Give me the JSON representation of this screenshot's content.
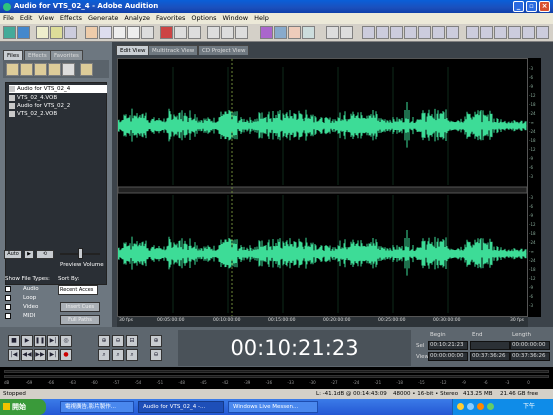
{
  "window": {
    "title": "Audio for VTS_02_4 - Adobe Audition"
  },
  "menu": [
    "File",
    "Edit",
    "View",
    "Effects",
    "Generate",
    "Analyze",
    "Favorites",
    "Options",
    "Window",
    "Help"
  ],
  "left": {
    "tabs": [
      "Files",
      "Effects",
      "Favorites"
    ],
    "files": [
      "Audio for VTS_02_4",
      "VTS_02_4.VOB",
      "Audio for VTS_02_2",
      "VTS_02_2.VOB"
    ],
    "auto_label": "Auto",
    "preview_volume": "Preview Volume",
    "show_file_types": "Show File Types:",
    "sort_by": "Sort By:",
    "sort_value": "Recent Acces",
    "types": [
      "Audio",
      "Loop",
      "Video",
      "MIDI"
    ],
    "insert_cue": "Insert Cues",
    "full_paths": "Full Paths"
  },
  "views": [
    "Edit View",
    "Multitrack View",
    "CD Project View"
  ],
  "timeline": [
    "30 fps",
    "00:05:00:00",
    "00:10:00:00",
    "00:15:00:00",
    "00:20:00:00",
    "00:25:00:00",
    "00:30:00:00",
    "30 fps"
  ],
  "ruler_top": [
    "-3",
    "-6",
    "-9",
    "-12",
    "-18",
    "-24",
    "-∞",
    "-24",
    "-18",
    "-12",
    "-9",
    "-6",
    "-3"
  ],
  "ruler_bot": [
    "-3",
    "-6",
    "-9",
    "-12",
    "-18",
    "-24",
    "-∞",
    "-24",
    "-18",
    "-12",
    "-9",
    "-6",
    "-3"
  ],
  "time_display": "00:10:21:23",
  "selection": {
    "headers": [
      "Begin",
      "End",
      "Length"
    ],
    "sel_label": "Sel",
    "view_label": "View",
    "sel": [
      "00:10:21:23",
      "",
      "00:00:00:00"
    ],
    "view": [
      "00:00:00:00",
      "00:37:36:26",
      "00:37:36:26"
    ]
  },
  "meter_scale": [
    "dB",
    "-69",
    "-66",
    "-63",
    "-60",
    "-57",
    "-54",
    "-51",
    "-48",
    "-45",
    "-42",
    "-39",
    "-36",
    "-33",
    "-30",
    "-27",
    "-24",
    "-21",
    "-18",
    "-15",
    "-12",
    "-9",
    "-6",
    "-3",
    "0"
  ],
  "status": {
    "state": "Stopped",
    "level": "L: -41.1dB @ 00:14:43:09",
    "format": "48000 • 16-bit • Stereo",
    "size": "413.25 MB",
    "free": "21.46 GB free"
  },
  "taskbar": {
    "start": "開始",
    "items": [
      "電視廣告,影片製作...",
      "Audio for VTS_02_4 -...",
      "Windows Live Messen..."
    ],
    "clock": "下午 12:49"
  },
  "colors": {
    "wave": "#3ddc97",
    "accent": "#0a5fd8"
  }
}
